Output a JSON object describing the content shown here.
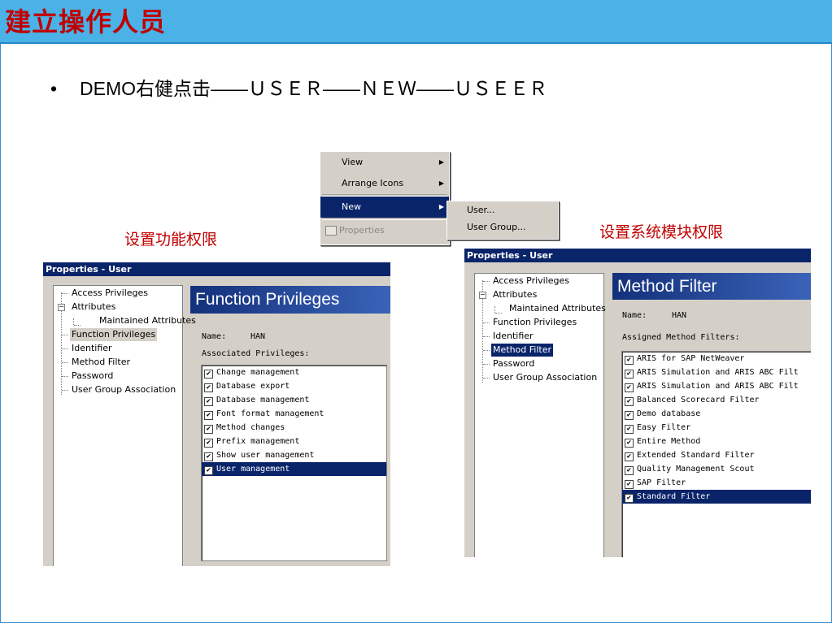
{
  "slide": {
    "title": "建立操作人员",
    "bullet_symbol": "•",
    "bullet_text": "DEMO右健点击——ＵＳＥＲ——ＮＥＷ——ＵＳＥＥＲ",
    "caption_left": "设置功能权限",
    "caption_right": "设置系统模块权限"
  },
  "context_menu": {
    "items": [
      "View",
      "Arrange Icons",
      "New",
      "Properties"
    ],
    "submenu": [
      "User...",
      "User Group..."
    ]
  },
  "dialog_left": {
    "title": "Properties - User",
    "tree": [
      "Access Privileges",
      "Attributes",
      "Maintained Attributes",
      "Function Privileges",
      "Identifier",
      "Method Filter",
      "Password",
      "User Group Association"
    ],
    "expander": "−",
    "panel_title": "Function Privileges",
    "name_label": "Name:",
    "name_value": "HAN",
    "list_label": "Associated Privileges:",
    "items": [
      "Change management",
      "Database export",
      "Database management",
      "Font format management",
      "Method changes",
      "Prefix management",
      "Show user management",
      "User management"
    ]
  },
  "dialog_right": {
    "title": "Properties - User",
    "tree": [
      "Access Privileges",
      "Attributes",
      "Maintained Attributes",
      "Function Privileges",
      "Identifier",
      "Method Filter",
      "Password",
      "User Group Association"
    ],
    "expander": "−",
    "panel_title": "Method Filter",
    "name_label": "Name:",
    "name_value": "HAN",
    "list_label": "Assigned Method Filters:",
    "items": [
      "ARIS for SAP NetWeaver",
      "ARIS Simulation and ARIS ABC Filt",
      "ARIS Simulation and ARIS ABC Filt",
      "Balanced Scorecard Filter",
      "Demo database",
      "Easy Filter",
      "Entire Method",
      "Extended Standard Filter",
      "Quality Management Scout",
      "SAP Filter",
      "Standard Filter"
    ]
  },
  "check_mark": "✔",
  "submenu_arrow": "▶",
  "colors": {
    "title_bar": "#4ab2e6",
    "title_text": "#c00000",
    "selection": "#0a246a"
  }
}
